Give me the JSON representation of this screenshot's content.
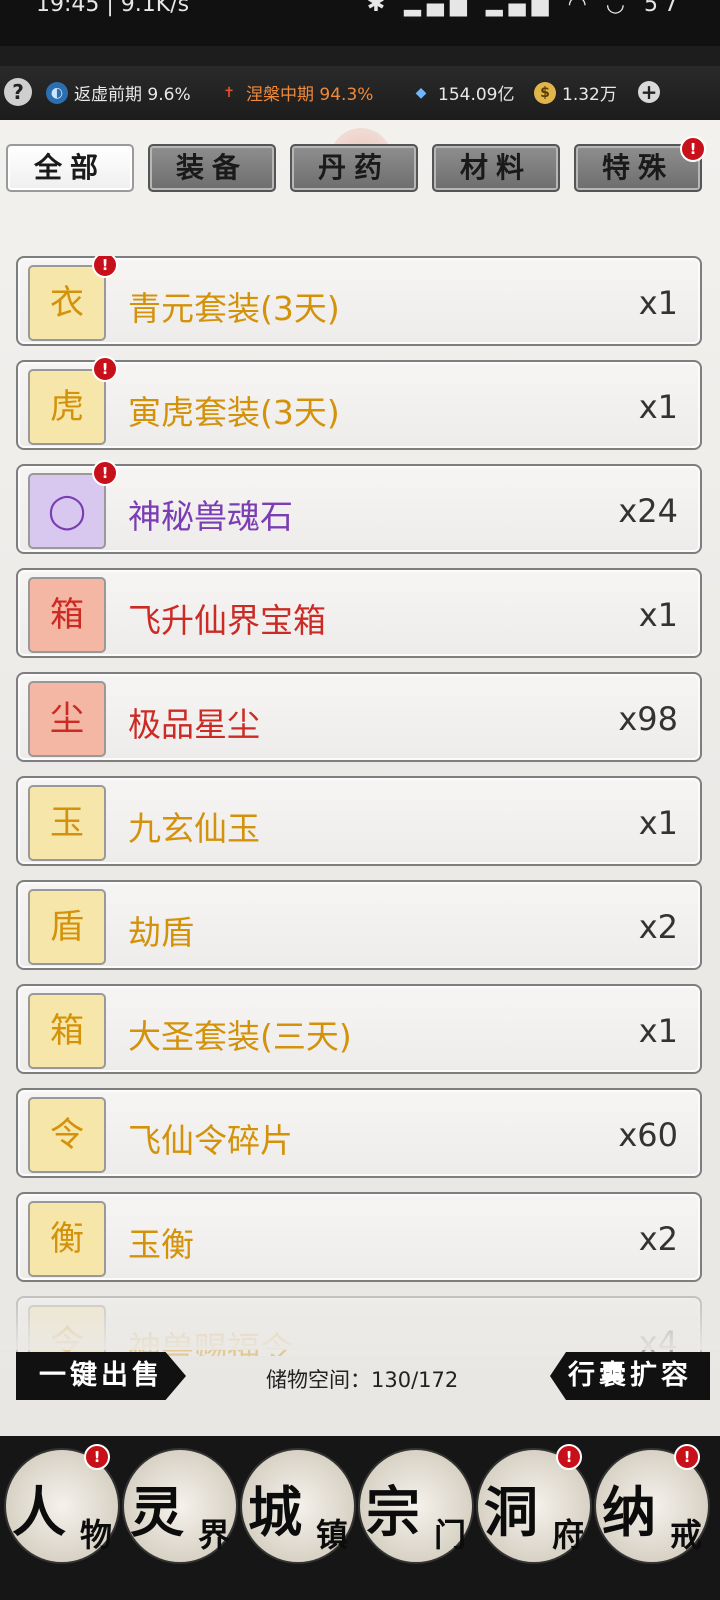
{
  "statusbar": {
    "time": "19:45 | 9.1K/s",
    "icons": "✱ ▂▄▆ ▂▄▆ ◠ ◡ 57"
  },
  "topbar": {
    "help": "?",
    "realm1": "返虚前期 9.6%",
    "realm2": "涅槃中期 94.3%",
    "stones": "154.09亿",
    "coins": "1.32万",
    "plus": "+"
  },
  "tabs": [
    {
      "label": "全部",
      "active": true,
      "badge": false
    },
    {
      "label": "装备",
      "active": false,
      "badge": false
    },
    {
      "label": "丹药",
      "active": false,
      "badge": false
    },
    {
      "label": "材料",
      "active": false,
      "badge": false
    },
    {
      "label": "特殊",
      "active": false,
      "badge": true
    }
  ],
  "badge_mark": "!",
  "items": [
    {
      "name": "青元套装(3天)",
      "count": "x1",
      "color": "#d4920a",
      "bg": "#f6e6a9",
      "glyph": "衣",
      "badge": true
    },
    {
      "name": "寅虎套装(3天)",
      "count": "x1",
      "color": "#d4920a",
      "bg": "#f6e6a9",
      "glyph": "虎",
      "badge": true
    },
    {
      "name": "神秘兽魂石",
      "count": "x24",
      "color": "#7a3db3",
      "bg": "#d8c8ef",
      "glyph": "◯",
      "badge": true
    },
    {
      "name": "飞升仙界宝箱",
      "count": "x1",
      "color": "#cc2a24",
      "bg": "#f4b7a4",
      "glyph": "箱",
      "badge": false
    },
    {
      "name": "极品星尘",
      "count": "x98",
      "color": "#cc2a24",
      "bg": "#f4b7a4",
      "glyph": "尘",
      "badge": false
    },
    {
      "name": "九玄仙玉",
      "count": "x1",
      "color": "#d4920a",
      "bg": "#f6e6a9",
      "glyph": "玉",
      "badge": false
    },
    {
      "name": "劫盾",
      "count": "x2",
      "color": "#d4920a",
      "bg": "#f6e6a9",
      "glyph": "盾",
      "badge": false
    },
    {
      "name": "大圣套装(三天)",
      "count": "x1",
      "color": "#d4920a",
      "bg": "#f6e6a9",
      "glyph": "箱",
      "badge": false
    },
    {
      "name": "飞仙令碎片",
      "count": "x60",
      "color": "#d4920a",
      "bg": "#f6e6a9",
      "glyph": "令",
      "badge": false
    },
    {
      "name": "玉衡",
      "count": "x2",
      "color": "#d4920a",
      "bg": "#f6e6a9",
      "glyph": "衡",
      "badge": false
    },
    {
      "name": "神兽赐福令",
      "count": "x4",
      "color": "#d4920a",
      "bg": "#f6e6a9",
      "glyph": "令",
      "badge": false
    }
  ],
  "footer": {
    "sell_all": "一键出售",
    "storage": "储物空间：130/172",
    "expand": "行囊扩容"
  },
  "nav": [
    {
      "big": "人",
      "small": "物",
      "badge": true
    },
    {
      "big": "灵",
      "small": "界",
      "badge": false
    },
    {
      "big": "城",
      "small": "镇",
      "badge": false
    },
    {
      "big": "宗",
      "small": "门",
      "badge": false
    },
    {
      "big": "洞",
      "small": "府",
      "badge": true
    },
    {
      "big": "纳",
      "small": "戒",
      "badge": true
    }
  ]
}
